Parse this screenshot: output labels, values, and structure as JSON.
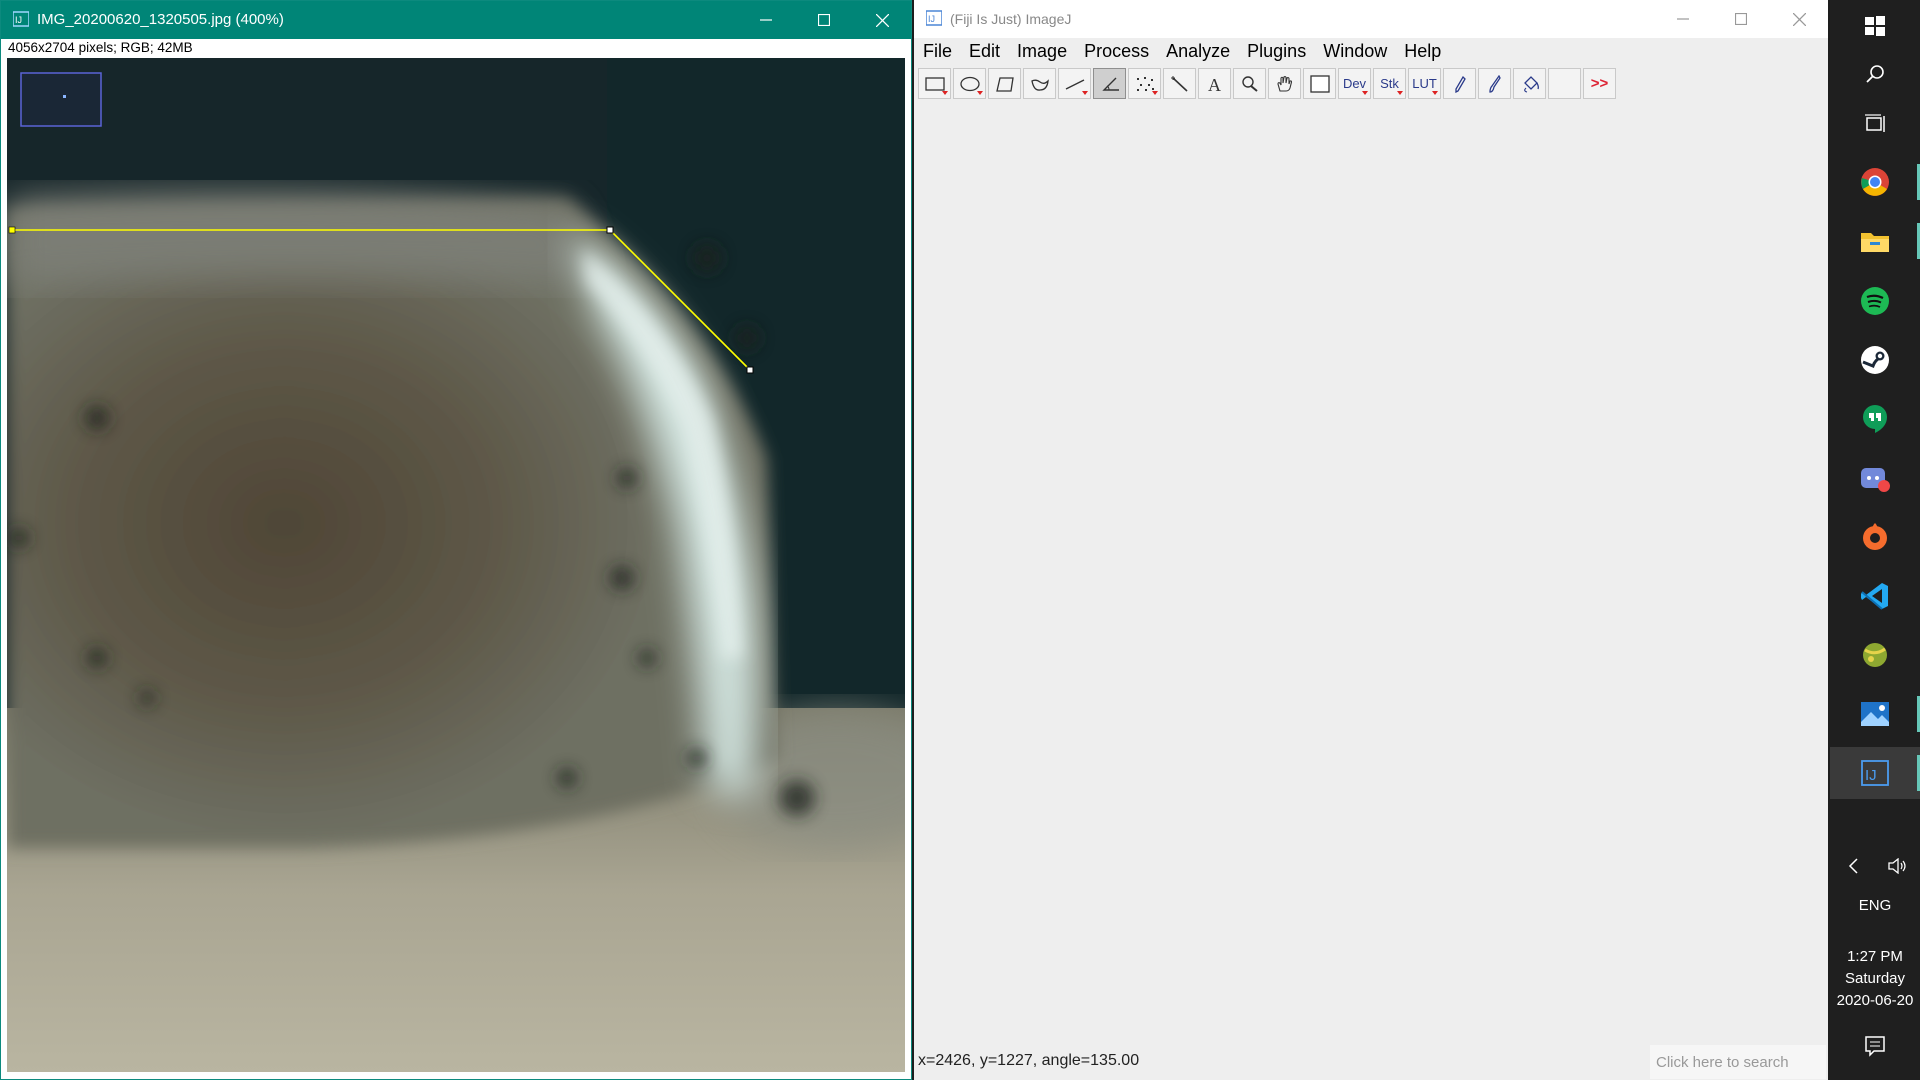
{
  "image_window": {
    "title": "IMG_20200620_1320505.jpg (400%)",
    "info": "4056x2704 pixels; RGB; 42MB",
    "buttons": [
      "minimize",
      "maximize",
      "close"
    ]
  },
  "imagej_window": {
    "title": "(Fiji Is Just) ImageJ",
    "menu": [
      "File",
      "Edit",
      "Image",
      "Process",
      "Analyze",
      "Plugins",
      "Window",
      "Help"
    ],
    "tools": [
      {
        "name": "rectangle-tool",
        "icon": "rectangle-icon",
        "dropdown": true
      },
      {
        "name": "oval-tool",
        "icon": "oval-icon",
        "dropdown": true
      },
      {
        "name": "polygon-tool",
        "icon": "polygon-icon",
        "dropdown": false
      },
      {
        "name": "freehand-tool",
        "icon": "freehand-icon",
        "dropdown": false
      },
      {
        "name": "line-tool",
        "icon": "line-icon",
        "dropdown": true
      },
      {
        "name": "angle-tool",
        "icon": "angle-icon",
        "dropdown": false,
        "selected": true
      },
      {
        "name": "point-tool",
        "icon": "multipoint-icon",
        "dropdown": true
      },
      {
        "name": "wand-tool",
        "icon": "wand-icon",
        "dropdown": false
      },
      {
        "name": "text-tool",
        "icon": "text-icon",
        "dropdown": false
      },
      {
        "name": "zoom-tool",
        "icon": "magnifier-icon",
        "dropdown": false
      },
      {
        "name": "hand-tool",
        "icon": "hand-icon",
        "dropdown": false
      },
      {
        "name": "color-picker-tool",
        "icon": "color-picker-icon",
        "dropdown": false
      },
      {
        "name": "developer-menu",
        "icon": "text-label",
        "label": "Dev",
        "dropdown": true
      },
      {
        "name": "stacks-menu",
        "icon": "text-label",
        "label": "Stk",
        "dropdown": true
      },
      {
        "name": "lut-menu",
        "icon": "text-label",
        "label": "LUT",
        "dropdown": true
      },
      {
        "name": "pencil-tool",
        "icon": "pencil-icon",
        "dropdown": false
      },
      {
        "name": "brush-tool",
        "icon": "brush-icon",
        "dropdown": false
      },
      {
        "name": "flood-fill-tool",
        "icon": "flood-fill-icon",
        "dropdown": false
      },
      {
        "name": "empty-tool-slot",
        "icon": "none",
        "dropdown": false
      },
      {
        "name": "more-tools-button",
        "icon": "more-tools-icon",
        "label": ">>",
        "dropdown": false
      }
    ],
    "status": "x=2426, y=1227, angle=135.00",
    "search_placeholder": "Click here to search"
  },
  "taskbar": {
    "icons": [
      "windows-start-icon",
      "search-icon",
      "task-view-icon",
      "chrome-icon",
      "file-explorer-icon",
      "spotify-icon",
      "steam-icon",
      "hangouts-icon",
      "discord-icon",
      "origin-icon",
      "vscode-icon",
      "ball-app-icon",
      "photos-icon",
      "fiji-icon"
    ],
    "tray": {
      "language": "ENG"
    },
    "clock": {
      "time": "1:27 PM",
      "day": "Saturday",
      "date": "2020-06-20"
    },
    "colors": {
      "running_indicator": "#66c7b8"
    }
  },
  "colors": {
    "image_titlebar": "#008577",
    "imagej_background": "#eeeeee",
    "selection_line": "#ffff00",
    "selected_tool": "#cfcfcf"
  }
}
